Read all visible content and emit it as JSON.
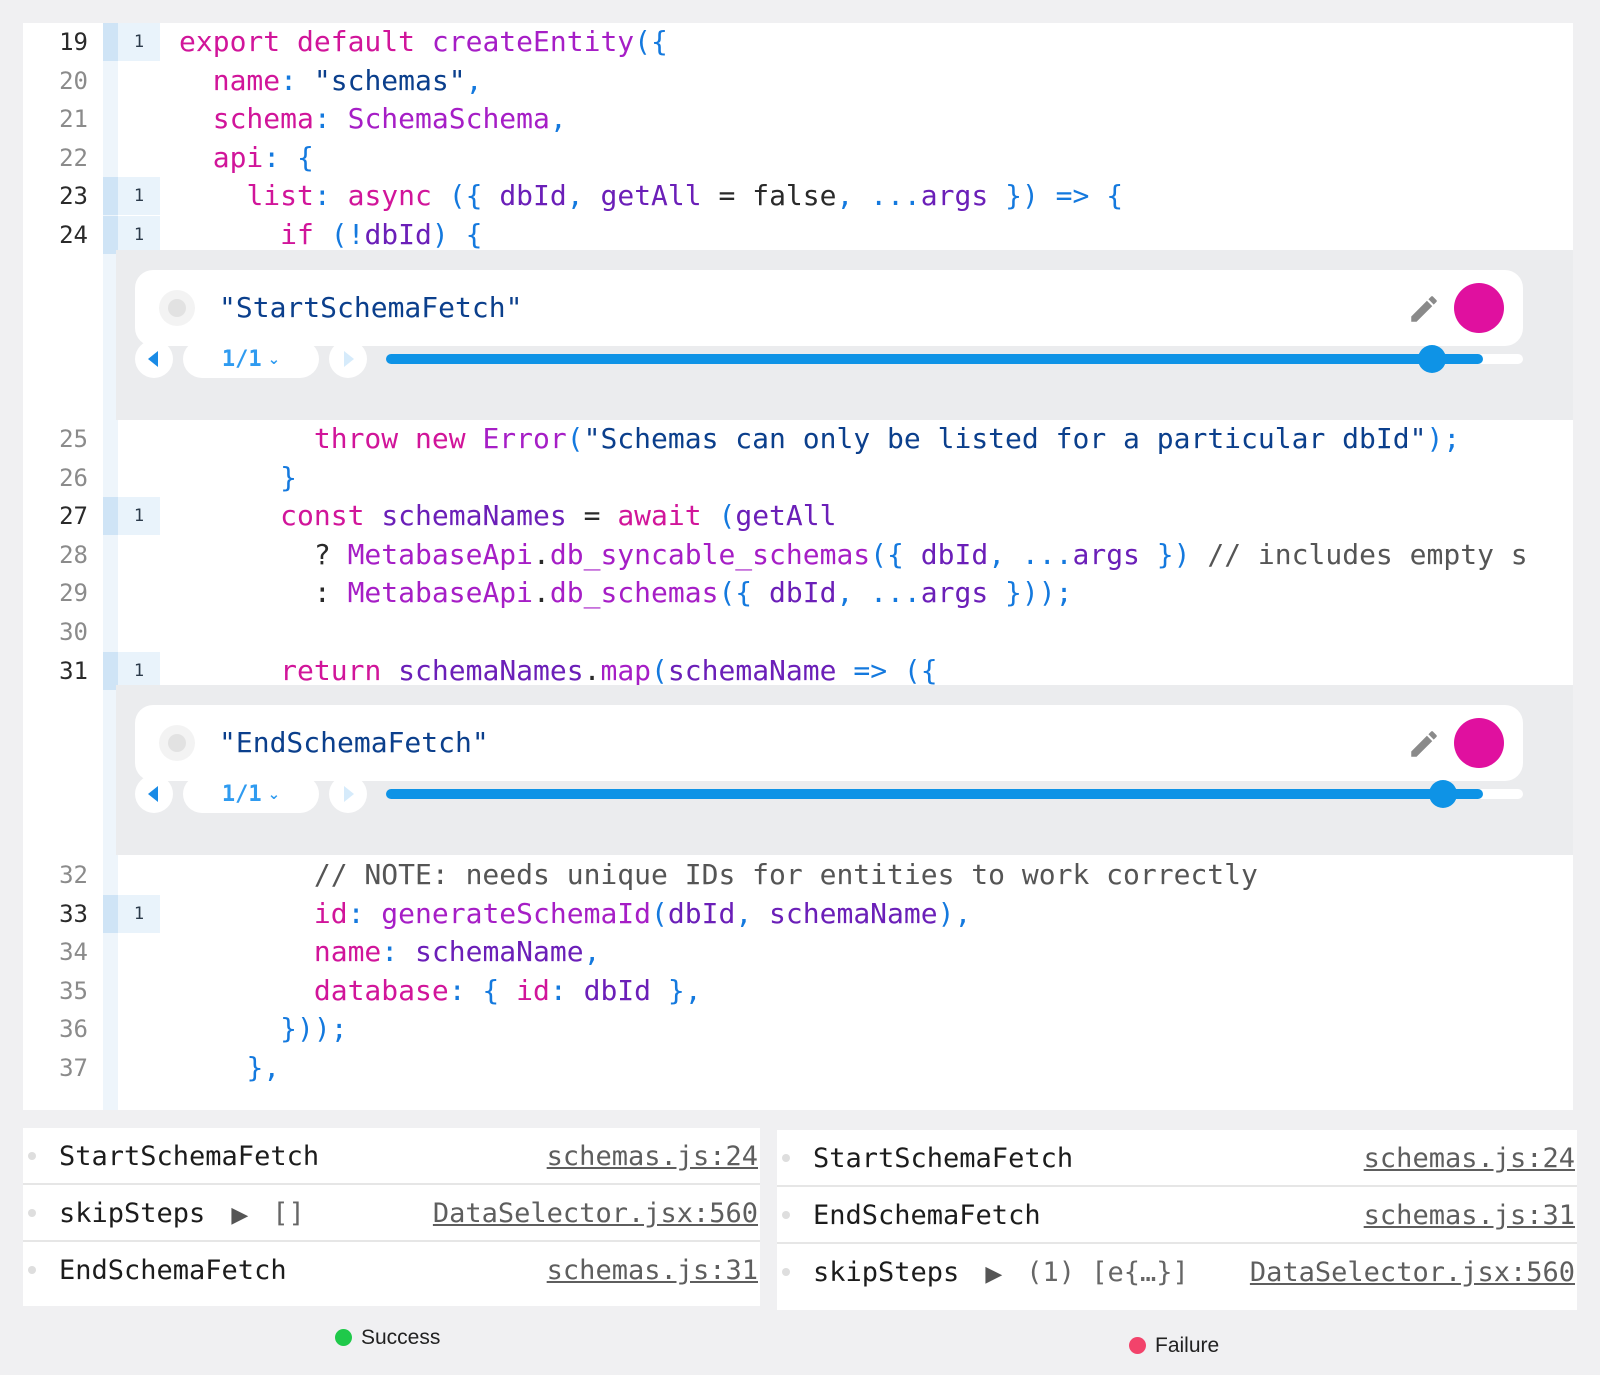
{
  "editor": {
    "lines_a": [
      {
        "num": "19",
        "hits": "1",
        "tokens": [
          {
            "c": "kw",
            "t": "export default "
          },
          {
            "c": "fn",
            "t": "createEntity"
          },
          {
            "c": "pun",
            "t": "({"
          }
        ]
      },
      {
        "num": "20",
        "hits": "",
        "tokens": [
          {
            "c": "",
            "t": "  "
          },
          {
            "c": "prop",
            "t": "name"
          },
          {
            "c": "pun",
            "t": ": "
          },
          {
            "c": "str",
            "t": "\"schemas\""
          },
          {
            "c": "pun",
            "t": ","
          }
        ]
      },
      {
        "num": "21",
        "hits": "",
        "tokens": [
          {
            "c": "",
            "t": "  "
          },
          {
            "c": "prop",
            "t": "schema"
          },
          {
            "c": "pun",
            "t": ": "
          },
          {
            "c": "fn",
            "t": "SchemaSchema"
          },
          {
            "c": "pun",
            "t": ","
          }
        ]
      },
      {
        "num": "22",
        "hits": "",
        "tokens": [
          {
            "c": "",
            "t": "  "
          },
          {
            "c": "prop",
            "t": "api"
          },
          {
            "c": "pun",
            "t": ": {"
          }
        ]
      },
      {
        "num": "23",
        "hits": "1",
        "tokens": [
          {
            "c": "",
            "t": "    "
          },
          {
            "c": "prop",
            "t": "list"
          },
          {
            "c": "pun",
            "t": ": "
          },
          {
            "c": "kw",
            "t": "async "
          },
          {
            "c": "pun",
            "t": "({ "
          },
          {
            "c": "var",
            "t": "dbId"
          },
          {
            "c": "pun",
            "t": ", "
          },
          {
            "c": "var",
            "t": "getAll"
          },
          {
            "c": "dark",
            "t": " = false"
          },
          {
            "c": "pun",
            "t": ", ..."
          },
          {
            "c": "var",
            "t": "args"
          },
          {
            "c": "pun",
            "t": " }) => {"
          }
        ]
      },
      {
        "num": "24",
        "hits": "1",
        "tokens": [
          {
            "c": "",
            "t": "      "
          },
          {
            "c": "kw",
            "t": "if "
          },
          {
            "c": "pun",
            "t": "(!"
          },
          {
            "c": "var",
            "t": "dbId"
          },
          {
            "c": "pun",
            "t": ") {"
          }
        ]
      }
    ],
    "lines_b": [
      {
        "num": "25",
        "hits": "",
        "tokens": [
          {
            "c": "",
            "t": "        "
          },
          {
            "c": "kw",
            "t": "throw new "
          },
          {
            "c": "fn",
            "t": "Error"
          },
          {
            "c": "pun",
            "t": "("
          },
          {
            "c": "str",
            "t": "\"Schemas can only be listed for a particular dbId\""
          },
          {
            "c": "pun",
            "t": ");"
          }
        ]
      },
      {
        "num": "26",
        "hits": "",
        "tokens": [
          {
            "c": "",
            "t": "      "
          },
          {
            "c": "pun",
            "t": "}"
          }
        ]
      },
      {
        "num": "27",
        "hits": "1",
        "tokens": [
          {
            "c": "",
            "t": "      "
          },
          {
            "c": "kw",
            "t": "const "
          },
          {
            "c": "var",
            "t": "schemaNames"
          },
          {
            "c": "dark",
            "t": " = "
          },
          {
            "c": "kw",
            "t": "await "
          },
          {
            "c": "pun",
            "t": "("
          },
          {
            "c": "var",
            "t": "getAll"
          }
        ]
      },
      {
        "num": "28",
        "hits": "",
        "tokens": [
          {
            "c": "",
            "t": "        "
          },
          {
            "c": "dark",
            "t": "? "
          },
          {
            "c": "fn",
            "t": "MetabaseApi"
          },
          {
            "c": "dark",
            "t": "."
          },
          {
            "c": "fn",
            "t": "db_syncable_schemas"
          },
          {
            "c": "pun",
            "t": "({ "
          },
          {
            "c": "var",
            "t": "dbId"
          },
          {
            "c": "pun",
            "t": ", ..."
          },
          {
            "c": "var",
            "t": "args"
          },
          {
            "c": "pun",
            "t": " }) "
          },
          {
            "c": "cmt",
            "t": "// includes empty s"
          }
        ]
      },
      {
        "num": "29",
        "hits": "",
        "tokens": [
          {
            "c": "",
            "t": "        "
          },
          {
            "c": "dark",
            "t": ": "
          },
          {
            "c": "fn",
            "t": "MetabaseApi"
          },
          {
            "c": "dark",
            "t": "."
          },
          {
            "c": "fn",
            "t": "db_schemas"
          },
          {
            "c": "pun",
            "t": "({ "
          },
          {
            "c": "var",
            "t": "dbId"
          },
          {
            "c": "pun",
            "t": ", ..."
          },
          {
            "c": "var",
            "t": "args"
          },
          {
            "c": "pun",
            "t": " }));"
          }
        ]
      },
      {
        "num": "30",
        "hits": "",
        "tokens": []
      },
      {
        "num": "31",
        "hits": "1",
        "tokens": [
          {
            "c": "",
            "t": "      "
          },
          {
            "c": "kw",
            "t": "return "
          },
          {
            "c": "var",
            "t": "schemaNames"
          },
          {
            "c": "dark",
            "t": "."
          },
          {
            "c": "fn",
            "t": "map"
          },
          {
            "c": "pun",
            "t": "("
          },
          {
            "c": "var",
            "t": "schemaName"
          },
          {
            "c": "pun",
            "t": " => ({"
          }
        ]
      }
    ],
    "lines_c": [
      {
        "num": "32",
        "hits": "",
        "tokens": [
          {
            "c": "",
            "t": "        "
          },
          {
            "c": "cmt",
            "t": "// NOTE: needs unique IDs for entities to work correctly"
          }
        ]
      },
      {
        "num": "33",
        "hits": "1",
        "tokens": [
          {
            "c": "",
            "t": "        "
          },
          {
            "c": "prop",
            "t": "id"
          },
          {
            "c": "pun",
            "t": ": "
          },
          {
            "c": "fn",
            "t": "generateSchemaId"
          },
          {
            "c": "pun",
            "t": "("
          },
          {
            "c": "var",
            "t": "dbId"
          },
          {
            "c": "pun",
            "t": ", "
          },
          {
            "c": "var",
            "t": "schemaName"
          },
          {
            "c": "pun",
            "t": "),"
          }
        ]
      },
      {
        "num": "34",
        "hits": "",
        "tokens": [
          {
            "c": "",
            "t": "        "
          },
          {
            "c": "prop",
            "t": "name"
          },
          {
            "c": "pun",
            "t": ": "
          },
          {
            "c": "var",
            "t": "schemaName"
          },
          {
            "c": "pun",
            "t": ","
          }
        ]
      },
      {
        "num": "35",
        "hits": "",
        "tokens": [
          {
            "c": "",
            "t": "        "
          },
          {
            "c": "prop",
            "t": "database"
          },
          {
            "c": "pun",
            "t": ": { "
          },
          {
            "c": "prop",
            "t": "id"
          },
          {
            "c": "pun",
            "t": ": "
          },
          {
            "c": "var",
            "t": "dbId"
          },
          {
            "c": "pun",
            "t": " },"
          }
        ]
      },
      {
        "num": "36",
        "hits": "",
        "tokens": [
          {
            "c": "",
            "t": "      "
          },
          {
            "c": "pun",
            "t": "}));"
          }
        ]
      },
      {
        "num": "37",
        "hits": "",
        "tokens": [
          {
            "c": "",
            "t": "    "
          },
          {
            "c": "pun",
            "t": "},"
          }
        ]
      }
    ]
  },
  "logpoints": [
    {
      "expression": "\"StartSchemaFetch\"",
      "counter": "1/1",
      "slider_value": 0.92,
      "color": "#e0109f"
    },
    {
      "expression": "\"EndSchemaFetch\"",
      "counter": "1/1",
      "slider_value": 0.93,
      "color": "#e0109f"
    }
  ],
  "consoles": {
    "success": {
      "rows": [
        {
          "message": "StartSchemaFetch",
          "arrow": "",
          "detail": "",
          "source": "schemas.js:24"
        },
        {
          "message": "skipSteps",
          "arrow": "▶",
          "detail": "[]",
          "source": "DataSelector.jsx:560"
        },
        {
          "message": "EndSchemaFetch",
          "arrow": "",
          "detail": "",
          "source": "schemas.js:31"
        }
      ],
      "legend": "Success",
      "legend_color": "#1fc94a"
    },
    "failure": {
      "rows": [
        {
          "message": "StartSchemaFetch",
          "arrow": "",
          "detail": "",
          "source": "schemas.js:24"
        },
        {
          "message": "EndSchemaFetch",
          "arrow": "",
          "detail": "",
          "source": "schemas.js:31"
        },
        {
          "message": "skipSteps",
          "arrow": "▶",
          "detail": "(1) [e{…}]",
          "source": "DataSelector.jsx:560"
        }
      ],
      "legend": "Failure",
      "legend_color": "#f2436b"
    }
  }
}
